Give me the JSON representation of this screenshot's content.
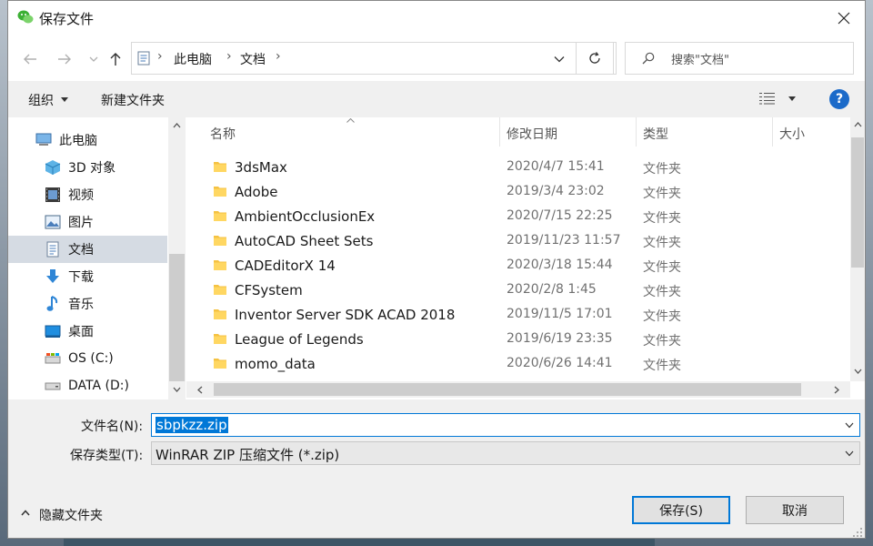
{
  "window": {
    "title": "保存文件"
  },
  "nav": {
    "back_icon": "arrow-left-icon",
    "forward_icon": "arrow-right-icon",
    "breadcrumb": [
      "此电脑",
      "文档"
    ],
    "search_placeholder": "搜索\"文档\""
  },
  "toolbar": {
    "organize": "组织",
    "new_folder": "新建文件夹",
    "help": "?"
  },
  "sidebar": {
    "items": [
      {
        "label": "此电脑",
        "icon": "computer-icon"
      },
      {
        "label": "3D 对象",
        "icon": "cube-icon"
      },
      {
        "label": "视频",
        "icon": "video-icon"
      },
      {
        "label": "图片",
        "icon": "picture-icon"
      },
      {
        "label": "文档",
        "icon": "document-icon",
        "selected": true
      },
      {
        "label": "下载",
        "icon": "download-icon"
      },
      {
        "label": "音乐",
        "icon": "music-icon"
      },
      {
        "label": "桌面",
        "icon": "desktop-icon"
      },
      {
        "label": "OS (C:)",
        "icon": "drive-icon"
      },
      {
        "label": "DATA (D:)",
        "icon": "drive-icon"
      }
    ]
  },
  "columns": {
    "name": "名称",
    "date": "修改日期",
    "type": "类型",
    "size": "大小"
  },
  "files": [
    {
      "name": "3dsMax",
      "date": "2020/4/7 15:41",
      "type": "文件夹"
    },
    {
      "name": "Adobe",
      "date": "2019/3/4 23:02",
      "type": "文件夹"
    },
    {
      "name": "AmbientOcclusionEx",
      "date": "2020/7/15 22:25",
      "type": "文件夹"
    },
    {
      "name": "AutoCAD Sheet Sets",
      "date": "2019/11/23 11:57",
      "type": "文件夹"
    },
    {
      "name": "CADEditorX 14",
      "date": "2020/3/18 15:44",
      "type": "文件夹"
    },
    {
      "name": "CFSystem",
      "date": "2020/2/8 1:45",
      "type": "文件夹"
    },
    {
      "name": "Inventor Server SDK ACAD 2018",
      "date": "2019/11/5 17:01",
      "type": "文件夹"
    },
    {
      "name": "League of Legends",
      "date": "2019/6/19 23:35",
      "type": "文件夹"
    },
    {
      "name": "momo_data",
      "date": "2020/6/26 14:41",
      "type": "文件夹"
    }
  ],
  "form": {
    "filename_label": "文件名(N):",
    "filename_value": "sbpkzz.zip",
    "filetype_label": "保存类型(T):",
    "filetype_value": "WinRAR ZIP 压缩文件 (*.zip)"
  },
  "footer": {
    "hide_folders": "隐藏文件夹",
    "save": "保存(S)",
    "cancel": "取消"
  },
  "colors": {
    "accent": "#0078d7",
    "folder": "#f5c242",
    "help": "#1b6ac9"
  }
}
